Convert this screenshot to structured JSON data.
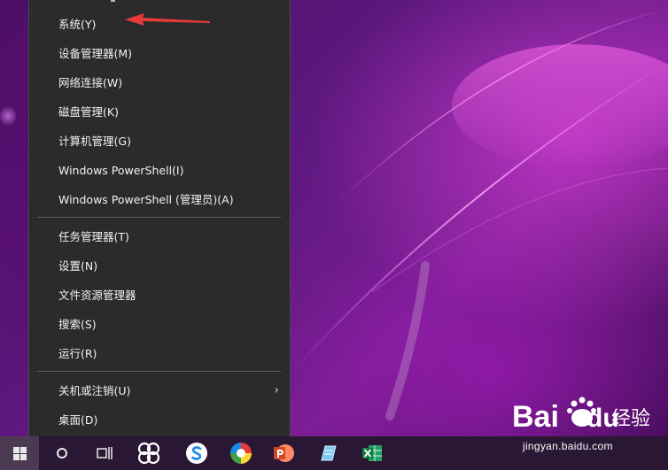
{
  "menu": {
    "items": [
      {
        "label": "系统(Y)"
      },
      {
        "label": "设备管理器(M)"
      },
      {
        "label": "网络连接(W)"
      },
      {
        "label": "磁盘管理(K)"
      },
      {
        "label": "计算机管理(G)"
      },
      {
        "label": "Windows PowerShell(I)"
      },
      {
        "label": "Windows PowerShell (管理员)(A)"
      },
      {
        "label": "任务管理器(T)"
      },
      {
        "label": "设置(N)"
      },
      {
        "label": "文件资源管理器"
      },
      {
        "label": "搜索(S)"
      },
      {
        "label": "运行(R)"
      },
      {
        "label": "关机或注销(U)",
        "submenu_icon": "chevron-right-icon"
      },
      {
        "label": "桌面(D)"
      }
    ]
  },
  "annotation": {
    "color": "#e83a3a",
    "icon": "red-arrow-annotation"
  },
  "taskbar": {
    "icons": [
      "windows-start-icon",
      "cortana-search-icon",
      "task-view-icon",
      "app-flower-icon",
      "sogou-input-icon",
      "browser-ball-icon",
      "powerpoint-icon",
      "notepad-icon",
      "excel-icon"
    ],
    "colors": {
      "background": "#2a1733",
      "start_active": "#4b3a52"
    }
  },
  "watermark": {
    "brand": "Bai",
    "brand_suffix": "du",
    "text": "经验",
    "url": "jingyan.baidu.com"
  },
  "theme": {
    "menu_bg": "#2b2b2b",
    "menu_text": "#f2f2f2",
    "separator": "#5c5c5c"
  }
}
